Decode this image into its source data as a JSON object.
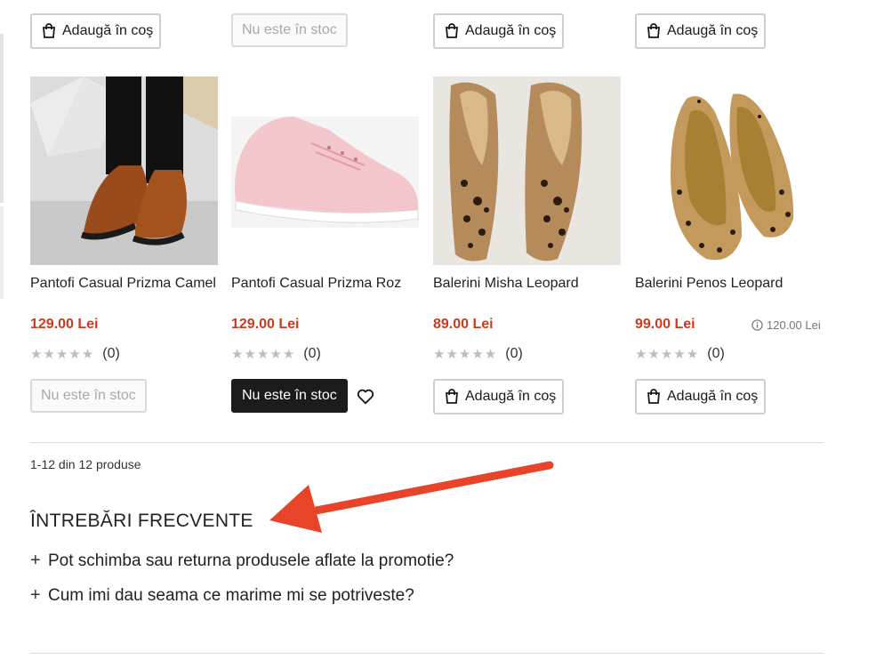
{
  "top_row": {
    "buttons": [
      {
        "label": "Adaugă în coş",
        "type": "cart"
      },
      {
        "label": "Nu este în stoc",
        "type": "disabled"
      },
      {
        "label": "Adaugă în coş",
        "type": "cart"
      },
      {
        "label": "Adaugă în coş",
        "type": "cart"
      }
    ]
  },
  "products": [
    {
      "name": "Pantofi Casual Prizma Camel",
      "price": "129.00 Lei",
      "rating_count": "(0)",
      "button": "Nu este în stoc"
    },
    {
      "name": "Pantofi Casual Prizma Roz",
      "price": "129.00 Lei",
      "rating_count": "(0)",
      "button": "Nu este în stoc"
    },
    {
      "name": "Balerini Misha Leopard",
      "price": "89.00 Lei",
      "rating_count": "(0)",
      "button": "Adaugă în coş"
    },
    {
      "name": "Balerini Penos Leopard",
      "price": "99.00 Lei",
      "old_price": "120.00 Lei",
      "rating_count": "(0)",
      "button": "Adaugă în coş"
    }
  ],
  "pagination": {
    "summary": "1-12 din 12 produse"
  },
  "faq": {
    "title": "ÎNTREBĂRI FRECVENTE",
    "items": [
      {
        "question": "Pot schimba sau returna produsele aflate la promotie?"
      },
      {
        "question": "Cum imi dau seama ce marime mi se potriveste?"
      }
    ]
  },
  "colors": {
    "price": "#cc3a1f",
    "annotation_arrow": "#e8442a",
    "dark_button": "#1c1c1c"
  },
  "icons": [
    "shopping-bag-icon",
    "heart-icon",
    "info-icon",
    "star-icon",
    "plus-icon",
    "arrow-annotation"
  ]
}
